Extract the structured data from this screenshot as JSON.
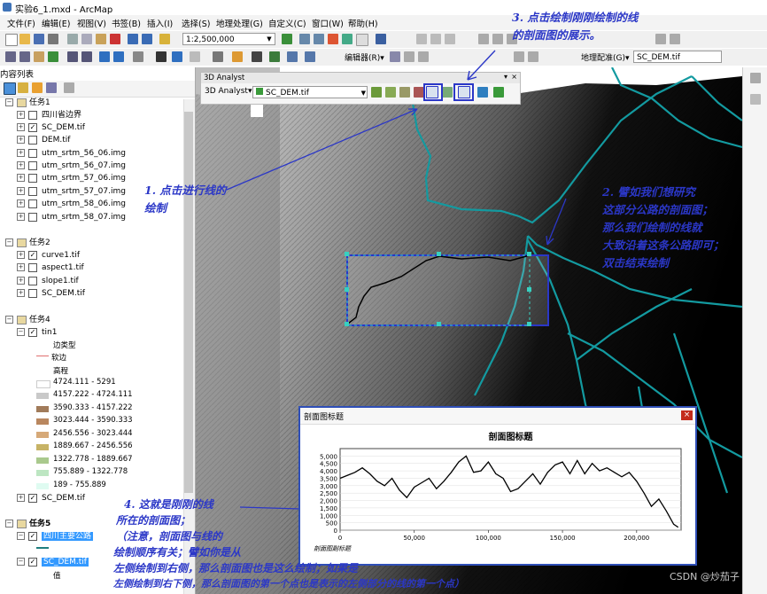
{
  "window": {
    "title": "实验6_1.mxd - ArcMap"
  },
  "menu": [
    "文件(F)",
    "编辑(E)",
    "视图(V)",
    "书签(B)",
    "插入(I)",
    "选择(S)",
    "地理处理(G)",
    "自定义(C)",
    "窗口(W)",
    "帮助(H)"
  ],
  "toolbar": {
    "scale": "1:2,500,000",
    "editor": "编辑器(R)▾",
    "georef": "地理配准(G)▾",
    "georef_layer": "SC_DEM.tif"
  },
  "analyst3d": {
    "window_title": "3D Analyst",
    "menu": "3D Analyst▾",
    "layer": "SC_DEM.tif"
  },
  "toc": {
    "title": "内容列表",
    "group1": {
      "name": "任务1",
      "layers": [
        "四川省边界",
        "SC_DEM.tif",
        "DEM.tif",
        "utm_srtm_56_06.img",
        "utm_srtm_56_07.img",
        "utm_srtm_57_06.img",
        "utm_srtm_57_07.img",
        "utm_srtm_58_06.img",
        "utm_srtm_58_07.img"
      ]
    },
    "group2": {
      "name": "任务2",
      "layers": [
        "curve1.tif",
        "aspect1.tif",
        "slope1.tif",
        "SC_DEM.tif"
      ]
    },
    "group4": {
      "name": "任务4",
      "tin": "tin1",
      "edge_type": "边类型",
      "soft_edge": "软边",
      "elevation": "高程",
      "classes": [
        "4724.111 - 5291",
        "4157.222 - 4724.111",
        "3590.333 - 4157.222",
        "3023.444 - 3590.333",
        "2456.556 - 3023.444",
        "1889.667 - 2456.556",
        "1322.778 - 1889.667",
        "755.889 - 1322.778",
        "189 - 755.889"
      ],
      "class_colors": [
        "#ffffff",
        "#c9c9c9",
        "#a17b5a",
        "#b9875f",
        "#d6a978",
        "#c7b366",
        "#a9c98d",
        "#bde6c2",
        "#dffbf1"
      ],
      "last_layer": "SC_DEM.tif"
    },
    "group5": {
      "name": "任务5",
      "road": "四川主要公路",
      "dem": "SC_DEM.tif",
      "value": "值"
    }
  },
  "profile": {
    "window_title": "剖面图标题",
    "chart_title": "剖面图标题",
    "subtitle": "剖面图副标题"
  },
  "annotations": {
    "a1": [
      "1. 点击进行线的",
      "绘制"
    ],
    "a2": [
      "2. 譬如我们想研究",
      "这部分公路的剖面图；",
      "那么我们绘制的线就",
      "大致沿着这条公路即可；",
      "双击结束绘制"
    ],
    "a3": [
      "3. 点击绘制刚刚绘制的线",
      "的剖面图的展示。"
    ],
    "a4": [
      "4. 这就是刚刚的线",
      "所在的剖面图；",
      "（注意，剖面图与线的",
      "绘制顺序有关；譬如你是从",
      "左侧绘制到右侧，那么剖面图也是这么绘制；如果是",
      "左侧绘制到右下侧，那么剖面图的第一个点也是表示的左侧部分的线的第一个点）"
    ]
  },
  "watermark": "CSDN @炒茄子",
  "chart_data": {
    "type": "line",
    "title": "剖面图标题",
    "subtitle": "剖面图副标题",
    "xlim": [
      0,
      230000
    ],
    "ylim": [
      0,
      5500
    ],
    "xticks": [
      "0",
      "50,000",
      "100,000",
      "150,000",
      "200,000"
    ],
    "yticks": [
      "0",
      "500",
      "1,000",
      "1,500",
      "2,000",
      "2,500",
      "3,000",
      "3,500",
      "4,000",
      "4,500",
      "5,000"
    ],
    "series": [
      {
        "x": [
          0,
          5000,
          10000,
          15000,
          20000,
          25000,
          30000,
          35000,
          40000,
          45000,
          50000,
          55000,
          60000,
          65000,
          70000,
          75000,
          80000,
          85000,
          90000,
          95000,
          100000,
          105000,
          110000,
          115000,
          120000,
          125000,
          130000,
          135000,
          140000,
          145000,
          150000,
          155000,
          160000,
          165000,
          170000,
          175000,
          180000,
          185000,
          190000,
          195000,
          200000,
          205000,
          210000,
          215000,
          220000,
          225000,
          228000
        ],
        "y": [
          3500,
          3700,
          3900,
          4200,
          3800,
          3300,
          3000,
          3500,
          2700,
          2200,
          2900,
          3200,
          3500,
          2800,
          3300,
          3900,
          4600,
          5000,
          3900,
          4000,
          4600,
          3800,
          3500,
          2600,
          2800,
          3300,
          3800,
          3100,
          3900,
          4400,
          4600,
          3800,
          4700,
          3800,
          4500,
          4000,
          4200,
          3900,
          3600,
          3900,
          3300,
          2500,
          1600,
          2100,
          1300,
          400,
          200
        ]
      }
    ]
  }
}
